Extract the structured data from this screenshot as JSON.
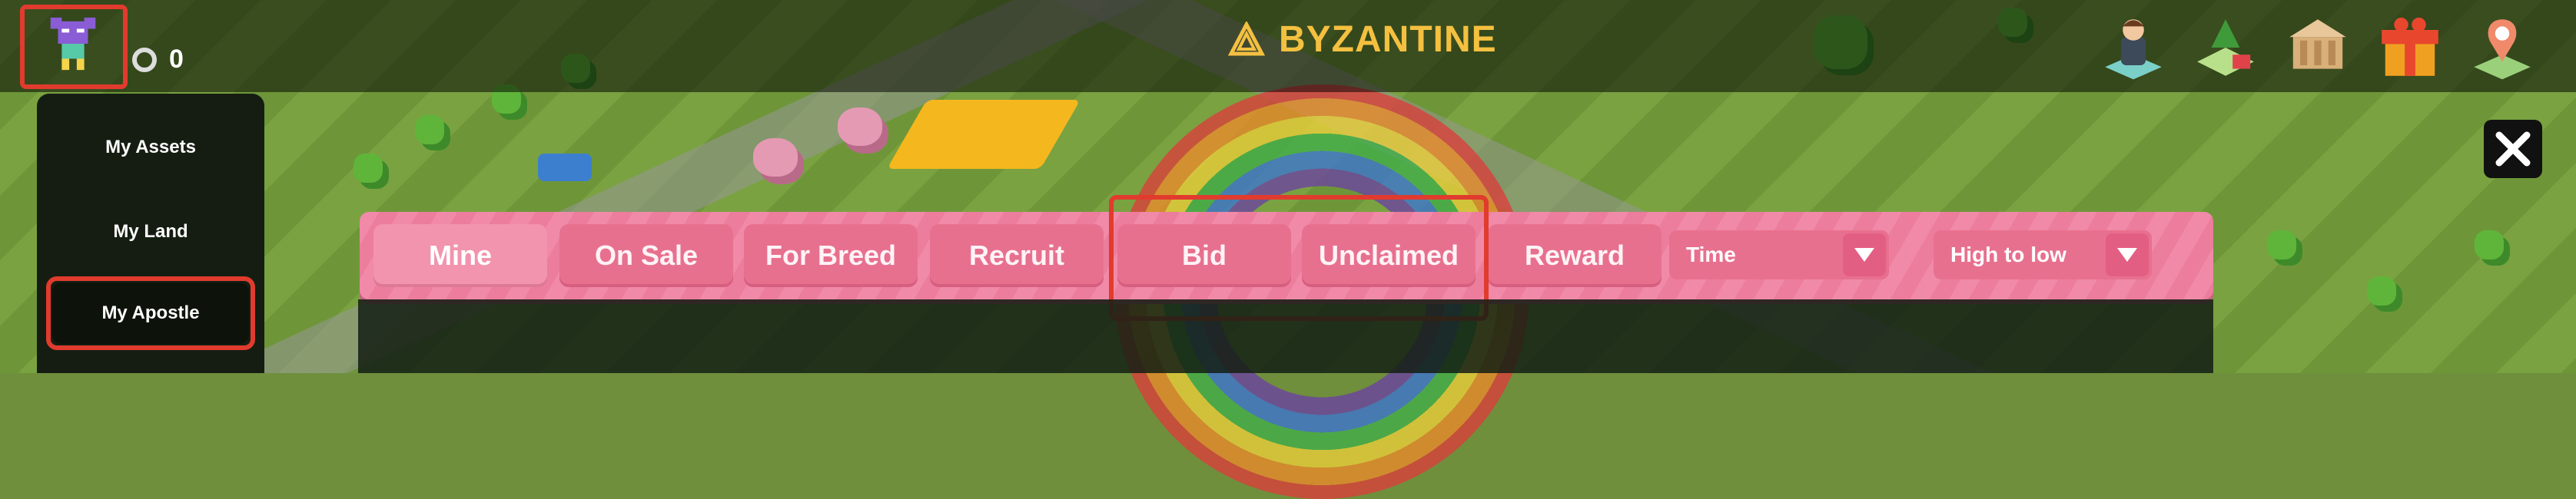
{
  "app": {
    "title": "BYZANTINE"
  },
  "player": {
    "balance": "0"
  },
  "sidebar": {
    "items": [
      {
        "label": "My Assets"
      },
      {
        "label": "My Land"
      },
      {
        "label": "My Apostle"
      }
    ]
  },
  "tabs": [
    {
      "label": "Mine"
    },
    {
      "label": "On Sale"
    },
    {
      "label": "For Breed"
    },
    {
      "label": "Recruit"
    },
    {
      "label": "Bid"
    },
    {
      "label": "Unclaimed"
    },
    {
      "label": "Reward"
    }
  ],
  "filters": {
    "sort_field": {
      "value": "Time"
    },
    "sort_order": {
      "value": "High to low"
    }
  },
  "top_icons": [
    "profile-icon",
    "land-market-icon",
    "bank-icon",
    "gift-icon",
    "location-icon"
  ],
  "colors": {
    "accent_red": "#e13b2e",
    "tab_pink": "#f08aa8",
    "title_gold": "#f4c040"
  }
}
